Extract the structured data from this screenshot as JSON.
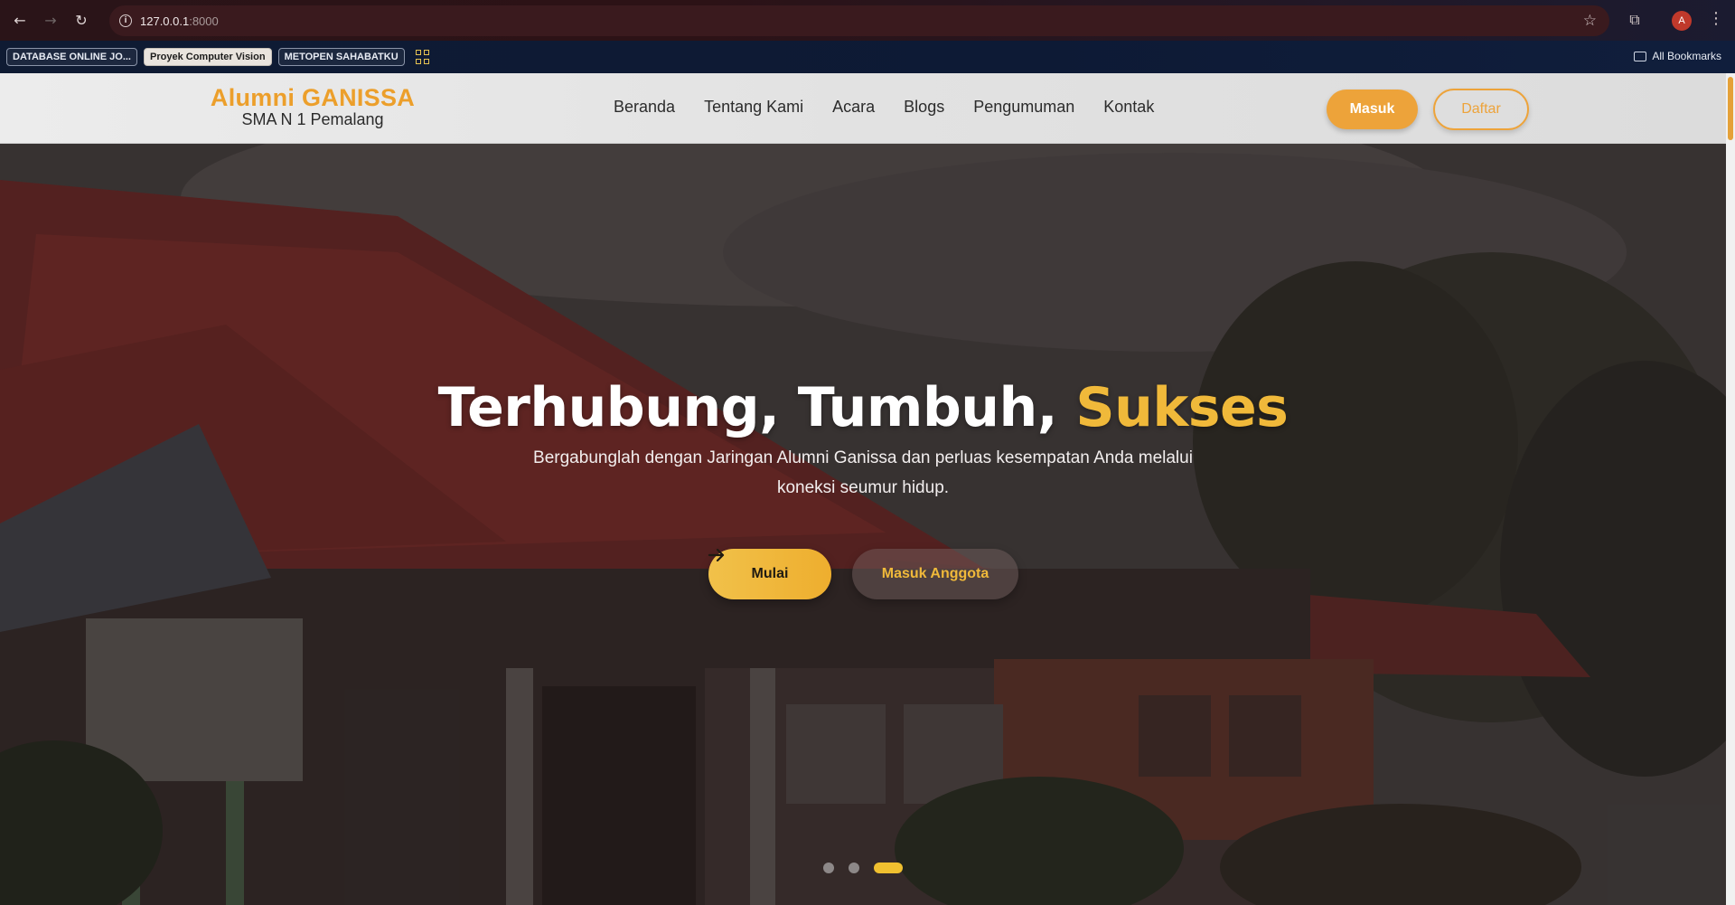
{
  "browser": {
    "url_host": "127.0.0.1",
    "url_port": ":8000",
    "profile_initial": "A",
    "bookmarks": [
      "DATABASE ONLINE JO...",
      "Proyek Computer Vision",
      "METOPEN SAHABATKU"
    ],
    "all_bookmarks_label": "All Bookmarks"
  },
  "site": {
    "brand_title": "Alumni GANISSA",
    "brand_subtitle": "SMA N 1 Pemalang",
    "nav": [
      "Beranda",
      "Tentang Kami",
      "Acara",
      "Blogs",
      "Pengumuman",
      "Kontak"
    ],
    "login_label": "Masuk",
    "register_label": "Daftar"
  },
  "hero": {
    "title_main": "Terhubung, Tumbuh, ",
    "title_accent": "Sukses",
    "description": "Bergabunglah dengan Jaringan Alumni Ganissa dan perluas kesempatan Anda melalui koneksi seumur hidup.",
    "start_label": "Mulai",
    "member_label": "Masuk Anggota",
    "slides_total": 3,
    "active_slide": 3
  },
  "colors": {
    "accent": "#EDA33A",
    "accent_yellow": "#F0B93A",
    "header_bg": "#E4E4E4"
  },
  "icons": [
    "back-arrow-icon",
    "forward-arrow-icon",
    "reload-icon",
    "site-info-icon",
    "bookmark-star-icon",
    "extensions-icon",
    "kebab-menu-icon",
    "apps-grid-icon",
    "folder-icon",
    "arrow-right-icon"
  ]
}
